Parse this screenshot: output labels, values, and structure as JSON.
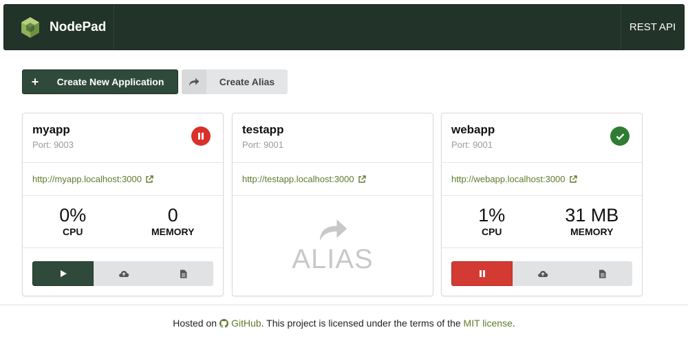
{
  "navbar": {
    "brand": "NodePad",
    "rest_api": "REST API"
  },
  "actions": {
    "create_label": "Create New Application",
    "alias_label": "Create Alias"
  },
  "apps": [
    {
      "name": "myapp",
      "port": "Port: 9003",
      "url": "http://myapp.localhost:3000",
      "status": "paused",
      "cpu": "0%",
      "cpu_label": "CPU",
      "memory": "0",
      "memory_label": "MEMORY"
    },
    {
      "name": "testapp",
      "port": "Port: 9001",
      "url": "http://testapp.localhost:3000",
      "alias_text": "ALIAS"
    },
    {
      "name": "webapp",
      "port": "Port: 9001",
      "url": "http://webapp.localhost:3000",
      "status": "running",
      "cpu": "1%",
      "cpu_label": "CPU",
      "memory": "31 MB",
      "memory_label": "MEMORY"
    }
  ],
  "footer": {
    "prefix": "Hosted on",
    "github": "GitHub",
    "middle": ". This project is licensed under the terms of the",
    "license": "MIT license",
    "suffix": "."
  },
  "colors": {
    "navbar": "#223329",
    "primary": "#2f4a3b",
    "link": "#5f7a2b",
    "danger": "#d9302a",
    "success": "#2e7d32"
  },
  "icons": {
    "logo": "nodepad-hex-logo",
    "external": "external-link-icon",
    "play": "play-icon",
    "pause": "pause-icon",
    "upload": "cloud-upload-icon",
    "logs": "document-icon",
    "share": "share-arrow-icon",
    "check": "check-icon",
    "github": "github-icon"
  }
}
